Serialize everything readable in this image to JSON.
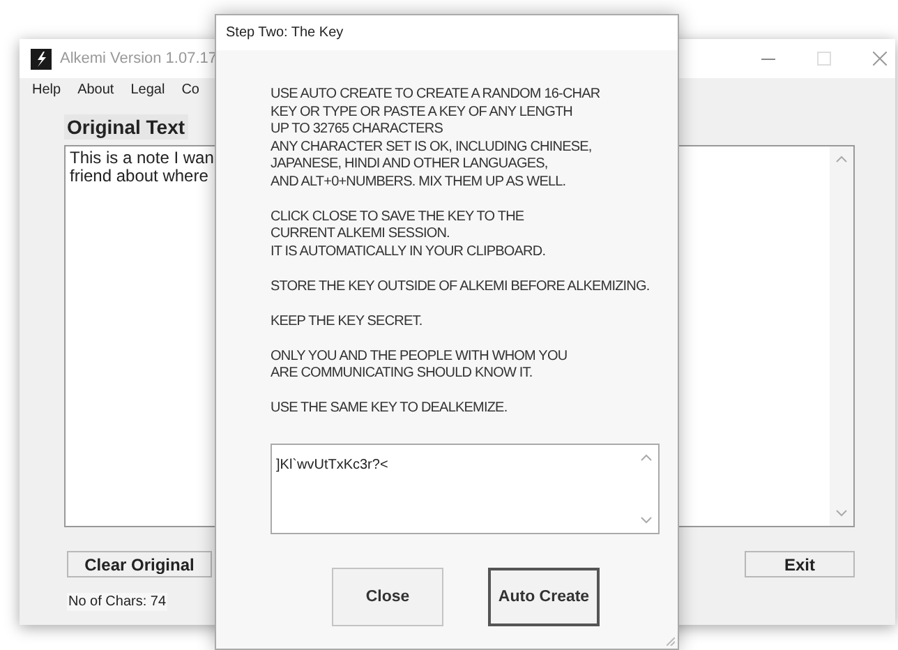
{
  "main_window": {
    "title": "Alkemi Version 1.07.17",
    "menu": [
      "Help",
      "About",
      "Legal",
      "Co"
    ],
    "original_label": "Original Text",
    "original_text": "This is a note I wan\nfriend about where",
    "buttons": [
      "Clear Original",
      "Exit"
    ],
    "status": "No of Chars: 74"
  },
  "dialog": {
    "title": "Step Two: The Key",
    "paragraphs": [
      "USE AUTO CREATE TO CREATE A RANDOM 16-CHAR\nKEY OR TYPE OR PASTE A KEY OF ANY LENGTH\nUP TO 32765 CHARACTERS\nANY CHARACTER SET IS OK, INCLUDING CHINESE,\nJAPANESE, HINDI AND OTHER LANGUAGES,\nAND ALT+0+NUMBERS. MIX THEM UP AS WELL.",
      "CLICK CLOSE TO SAVE THE KEY TO THE\nCURRENT ALKEMI SESSION.\nIT IS AUTOMATICALLY IN YOUR CLIPBOARD.",
      "STORE THE KEY OUTSIDE OF ALKEMI BEFORE ALKEMIZING.",
      "KEEP THE KEY SECRET.",
      "ONLY YOU AND THE PEOPLE WITH WHOM YOU\nARE COMMUNICATING SHOULD KNOW IT.",
      "USE THE SAME KEY TO DEALKEMIZE."
    ],
    "key_value": "]Kl`wvUtTxKc3r?<",
    "buttons": [
      {
        "label": "Close",
        "default": false
      },
      {
        "label": "Auto Create",
        "default": true
      }
    ]
  }
}
